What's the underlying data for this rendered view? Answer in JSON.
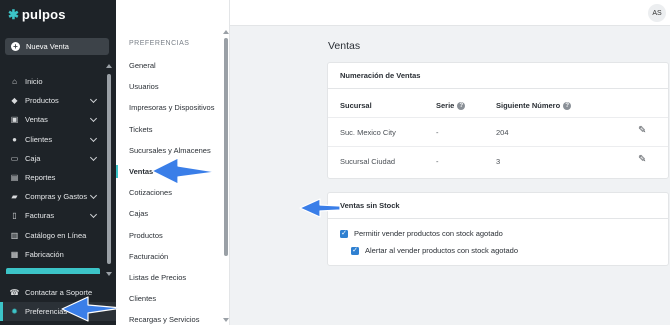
{
  "app": {
    "brand": "pulpos",
    "user_initials": "AS"
  },
  "sidebar": {
    "new_sale": "Nueva Venta",
    "items": [
      {
        "label": "Inicio",
        "icon": "home-icon",
        "has_chevron": false
      },
      {
        "label": "Productos",
        "icon": "tag-icon",
        "has_chevron": true
      },
      {
        "label": "Ventas",
        "icon": "cart-icon",
        "has_chevron": true
      },
      {
        "label": "Clientes",
        "icon": "user-icon",
        "has_chevron": true
      },
      {
        "label": "Caja",
        "icon": "inbox-icon",
        "has_chevron": true
      },
      {
        "label": "Reportes",
        "icon": "chart-icon",
        "has_chevron": false
      },
      {
        "label": "Compras y Gastos",
        "icon": "truck-icon",
        "has_chevron": true
      },
      {
        "label": "Facturas",
        "icon": "invoice-icon",
        "has_chevron": true
      },
      {
        "label": "Catálogo en Línea",
        "icon": "book-icon",
        "has_chevron": false
      },
      {
        "label": "Fabricación",
        "icon": "factory-icon",
        "has_chevron": false
      }
    ],
    "support": "Contactar a Soporte",
    "preferences": "Preferencias"
  },
  "preferences_menu": {
    "heading": "PREFERENCIAS",
    "items": [
      "General",
      "Usuarios",
      "Impresoras y Dispositivos",
      "Tickets",
      "Sucursales y Almacenes",
      "Ventas",
      "Cotizaciones",
      "Cajas",
      "Productos",
      "Facturación",
      "Listas de Precios",
      "Clientes",
      "Recargas y Servicios"
    ],
    "active": "Ventas"
  },
  "main": {
    "title": "Ventas",
    "numbering": {
      "heading": "Numeración de Ventas",
      "columns": {
        "branch": "Sucursal",
        "series": "Serie",
        "next": "Siguiente Número"
      },
      "rows": [
        {
          "branch": "Suc. Mexico City",
          "series": "-",
          "next": "204"
        },
        {
          "branch": "Sucursal Ciudad",
          "series": "-",
          "next": "3"
        }
      ]
    },
    "no_stock": {
      "heading": "Ventas sin Stock",
      "allow_label": "Permitir vender productos con stock agotado",
      "alert_label": "Alertar al vender productos con stock agotado"
    }
  },
  "colors": {
    "accent": "#3cc4c8",
    "sidebar_bg": "#1e2328",
    "annotation_arrow": "#3a7ee8",
    "checkbox": "#2f80d1"
  }
}
